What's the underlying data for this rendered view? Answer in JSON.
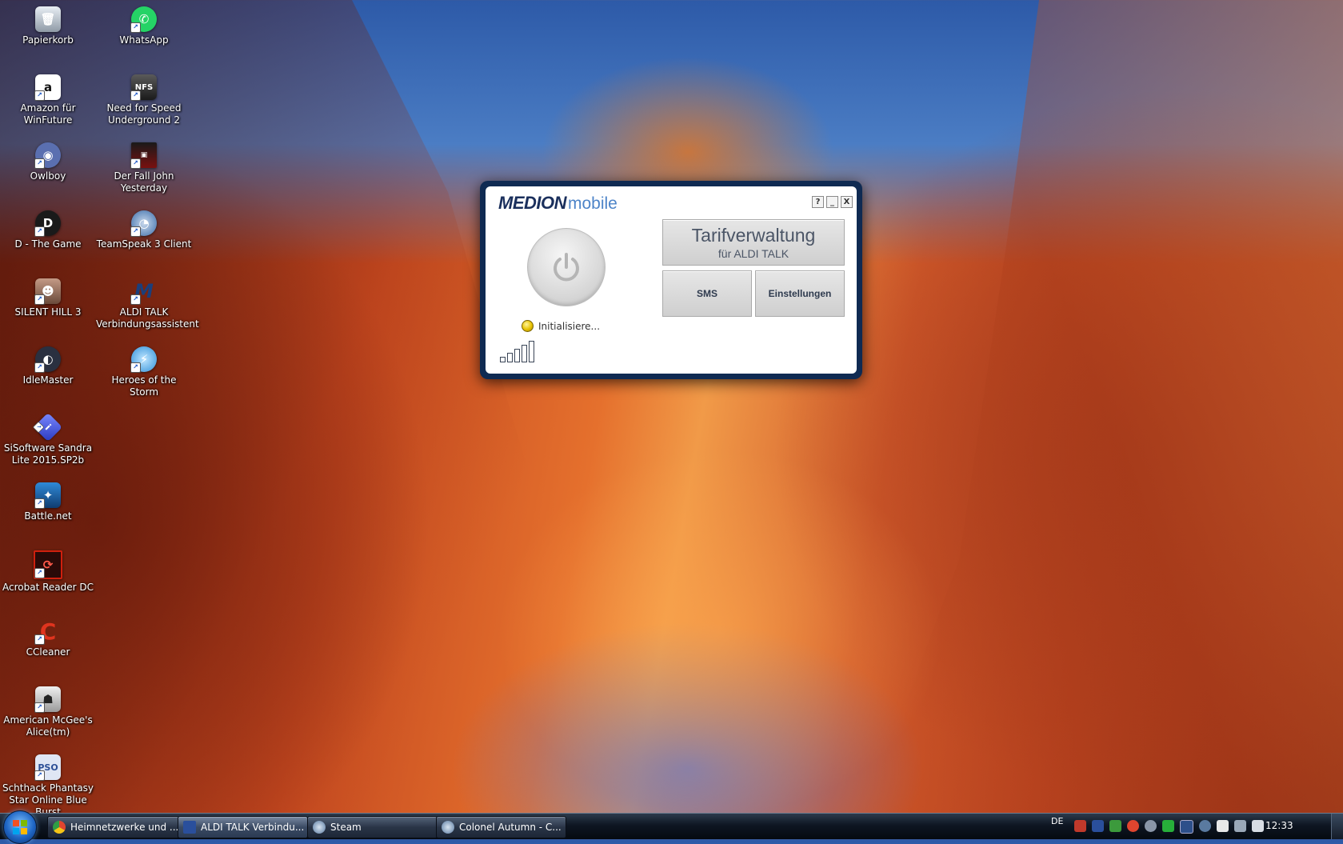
{
  "desktop": {
    "icons": [
      {
        "label": "Papierkorb",
        "icon": "recycle-bin-icon",
        "color": "#9aa6b2"
      },
      {
        "label": "WhatsApp",
        "icon": "whatsapp-icon",
        "color": "#25d366"
      },
      {
        "label": "Amazon für WinFuture",
        "icon": "amazon-icon",
        "color": "#ffffff"
      },
      {
        "label": "Need for Speed Underground 2",
        "icon": "nfs-icon",
        "color": "#2a2a2a"
      },
      {
        "label": "Owlboy",
        "icon": "owlboy-icon",
        "color": "#5a6fb0"
      },
      {
        "label": "Der Fall John Yesterday",
        "icon": "john-yesterday-icon",
        "color": "#7a1010"
      },
      {
        "label": "D - The Game",
        "icon": "d-game-icon",
        "color": "#1a1a1a"
      },
      {
        "label": "TeamSpeak 3 Client",
        "icon": "teamspeak-icon",
        "color": "#3a6ca8"
      },
      {
        "label": "SILENT HILL 3",
        "icon": "silent-hill-icon",
        "color": "#8a6a5a"
      },
      {
        "label": "ALDI TALK Verbindungsassistent",
        "icon": "medion-m-icon",
        "color": "#1a2f5c"
      },
      {
        "label": "IdleMaster",
        "icon": "idlemaster-icon",
        "color": "#2a3040"
      },
      {
        "label": "Heroes of the Storm",
        "icon": "heroes-storm-icon",
        "color": "#2f8fd8"
      },
      {
        "label": "SiSoftware Sandra Lite 2015.SP2b",
        "icon": "sandra-icon",
        "color": "#4a5ad0"
      },
      {
        "label": "Battle.net",
        "icon": "battlenet-icon",
        "color": "#1c5a9a"
      },
      {
        "label": "Acrobat Reader DC",
        "icon": "acrobat-icon",
        "color": "#b30b00"
      },
      {
        "label": "CCleaner",
        "icon": "ccleaner-icon",
        "color": "#d2301e"
      },
      {
        "label": "American McGee's Alice(tm)",
        "icon": "alice-icon",
        "color": "#d8d8d8"
      },
      {
        "label": "Schthack Phantasy Star Online Blue Burst",
        "icon": "pso-icon",
        "color": "#2c4f96"
      }
    ]
  },
  "medion": {
    "logo_brand": "MEDION",
    "logo_product": "mobile",
    "controls": {
      "help": "?",
      "minimize": "_",
      "close": "X"
    },
    "status_text": "Initialisiere...",
    "tarif_title": "Tarifverwaltung",
    "tarif_sub": "für ALDI TALK",
    "sms_label": "SMS",
    "settings_label": "Einstellungen"
  },
  "taskbar": {
    "tasks": [
      {
        "label": "Heimnetzwerke und ...",
        "icon": "chrome-icon",
        "color": "#e0452f"
      },
      {
        "label": "ALDI TALK Verbindu...",
        "icon": "medion-m-icon",
        "color": "#2a4f9c"
      },
      {
        "label": "Steam",
        "icon": "steam-icon",
        "color": "#5a7aa0"
      },
      {
        "label": "Colonel Autumn - C...",
        "icon": "steam-icon",
        "color": "#5a7aa0"
      }
    ],
    "language": "DE",
    "clock": "12:33"
  }
}
